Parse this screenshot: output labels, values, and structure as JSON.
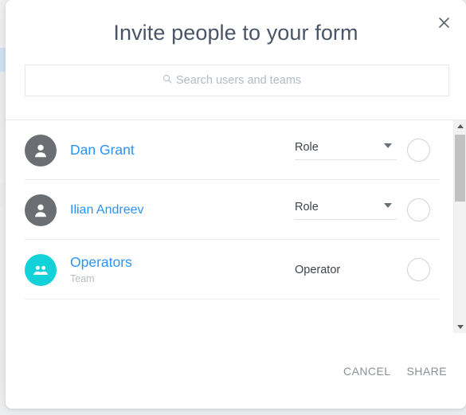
{
  "dialog": {
    "title": "Invite people to your form",
    "close_icon": "close-icon"
  },
  "search": {
    "placeholder": "Search users and teams",
    "value": "",
    "icon": "search-icon"
  },
  "list": {
    "rows": [
      {
        "name": "Dan Grant",
        "subtitle": "",
        "avatar_type": "person",
        "avatar_color": "#6b6f73",
        "role_label": "Role",
        "role_is_dropdown": true,
        "selected": false
      },
      {
        "name": "Ilian Andreev",
        "subtitle": "",
        "avatar_type": "person",
        "avatar_color": "#6b6f73",
        "role_label": "Role",
        "role_is_dropdown": true,
        "selected": false
      },
      {
        "name": "Operators",
        "subtitle": "Team",
        "avatar_type": "team",
        "avatar_color": "#12d1d8",
        "role_label": "Operator",
        "role_is_dropdown": false,
        "selected": false
      }
    ]
  },
  "scrollbar": {
    "up_icon": "triangle-up-icon",
    "down_icon": "triangle-down-icon"
  },
  "footer": {
    "cancel_label": "CANCEL",
    "share_label": "SHARE"
  },
  "colors": {
    "title": "#4a5568",
    "name_link": "#2b93f5",
    "team_accent": "#12d1d8",
    "muted": "#b9bcc1"
  }
}
